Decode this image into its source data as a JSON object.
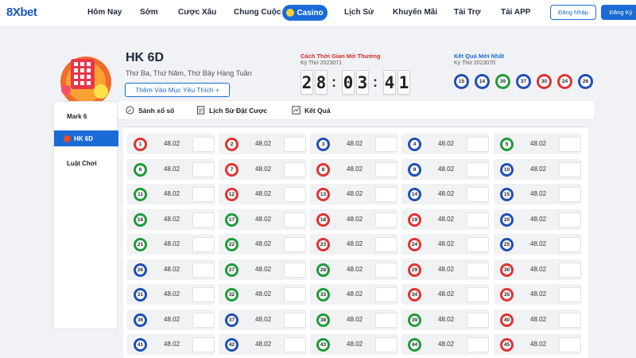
{
  "brand": {
    "logo_text": "8Xbet",
    "accent": "#1a6bd6"
  },
  "nav": {
    "items": [
      "Hôm Nay",
      "Sớm",
      "Cược Xâu",
      "Chung Cuộc",
      "Casino",
      "Lịch Sử",
      "Khuyến Mãi",
      "Tài Trợ",
      "Tải APP"
    ],
    "login": "Đăng Nhập",
    "register": "Đăng Ký"
  },
  "game": {
    "title": "HK 6D",
    "schedule": "Thứ Ba, Thứ Năm, Thứ Bảy Hàng Tuần",
    "favorite_button": "Thêm Vào Mục Yêu Thích +"
  },
  "countdown": {
    "label": "Cách Thời Gian Mở Thưởng",
    "period": "Kỳ Thứ 2023071",
    "digits": [
      "2",
      "8",
      "0",
      "3",
      "4",
      "1"
    ]
  },
  "latest_result": {
    "label": "Kết Quả Mới Nhất",
    "period": "Kỳ Thứ 2023070",
    "balls": [
      {
        "number": "15",
        "color": "blue"
      },
      {
        "number": "14",
        "color": "blue"
      },
      {
        "number": "39",
        "color": "green"
      },
      {
        "number": "37",
        "color": "blue"
      },
      {
        "number": "30",
        "color": "red"
      },
      {
        "number": "24",
        "color": "red"
      },
      {
        "number": "26",
        "color": "blue"
      }
    ]
  },
  "sidebar": {
    "items": [
      "Mark 6",
      "HK 6D",
      "Luật Chơi"
    ]
  },
  "tabs": [
    "Sảnh xổ số",
    "Lịch Sử Đặt Cược",
    "Kết Quả"
  ],
  "ball_colors": {
    "red": "#e03232",
    "green": "#1f9a3a",
    "blue": "#1f4fb5"
  },
  "bets": [
    {
      "number": "1",
      "color": "red",
      "odds": "48.02"
    },
    {
      "number": "2",
      "color": "red",
      "odds": "48.02"
    },
    {
      "number": "3",
      "color": "blue",
      "odds": "48.02"
    },
    {
      "number": "4",
      "color": "blue",
      "odds": "48.02"
    },
    {
      "number": "5",
      "color": "green",
      "odds": "48.02"
    },
    {
      "number": "6",
      "color": "green",
      "odds": "48.02"
    },
    {
      "number": "7",
      "color": "red",
      "odds": "48.02"
    },
    {
      "number": "8",
      "color": "red",
      "odds": "48.02"
    },
    {
      "number": "9",
      "color": "blue",
      "odds": "48.02"
    },
    {
      "number": "10",
      "color": "blue",
      "odds": "48.02"
    },
    {
      "number": "11",
      "color": "green",
      "odds": "48.02"
    },
    {
      "number": "12",
      "color": "red",
      "odds": "48.02"
    },
    {
      "number": "13",
      "color": "red",
      "odds": "48.02"
    },
    {
      "number": "14",
      "color": "blue",
      "odds": "48.02"
    },
    {
      "number": "15",
      "color": "blue",
      "odds": "48.02"
    },
    {
      "number": "16",
      "color": "green",
      "odds": "48.02"
    },
    {
      "number": "17",
      "color": "green",
      "odds": "48.02"
    },
    {
      "number": "18",
      "color": "red",
      "odds": "48.02"
    },
    {
      "number": "19",
      "color": "red",
      "odds": "48.02"
    },
    {
      "number": "20",
      "color": "blue",
      "odds": "48.02"
    },
    {
      "number": "21",
      "color": "green",
      "odds": "48.02"
    },
    {
      "number": "22",
      "color": "green",
      "odds": "48.02"
    },
    {
      "number": "23",
      "color": "red",
      "odds": "48.02"
    },
    {
      "number": "24",
      "color": "red",
      "odds": "48.02"
    },
    {
      "number": "25",
      "color": "blue",
      "odds": "48.02"
    },
    {
      "number": "26",
      "color": "blue",
      "odds": "48.02"
    },
    {
      "number": "27",
      "color": "green",
      "odds": "48.02"
    },
    {
      "number": "28",
      "color": "green",
      "odds": "48.02"
    },
    {
      "number": "29",
      "color": "red",
      "odds": "48.02"
    },
    {
      "number": "30",
      "color": "red",
      "odds": "48.02"
    },
    {
      "number": "31",
      "color": "blue",
      "odds": "48.02"
    },
    {
      "number": "32",
      "color": "green",
      "odds": "48.02"
    },
    {
      "number": "33",
      "color": "green",
      "odds": "48.02"
    },
    {
      "number": "34",
      "color": "red",
      "odds": "48.02"
    },
    {
      "number": "35",
      "color": "red",
      "odds": "48.02"
    },
    {
      "number": "36",
      "color": "blue",
      "odds": "48.02"
    },
    {
      "number": "37",
      "color": "blue",
      "odds": "48.02"
    },
    {
      "number": "38",
      "color": "green",
      "odds": "48.02"
    },
    {
      "number": "39",
      "color": "green",
      "odds": "48.02"
    },
    {
      "number": "40",
      "color": "red",
      "odds": "48.02"
    },
    {
      "number": "41",
      "color": "blue",
      "odds": "48.02"
    },
    {
      "number": "42",
      "color": "blue",
      "odds": "48.02"
    },
    {
      "number": "43",
      "color": "green",
      "odds": "48.02"
    },
    {
      "number": "44",
      "color": "green",
      "odds": "48.02"
    },
    {
      "number": "45",
      "color": "red",
      "odds": "48.02"
    }
  ]
}
